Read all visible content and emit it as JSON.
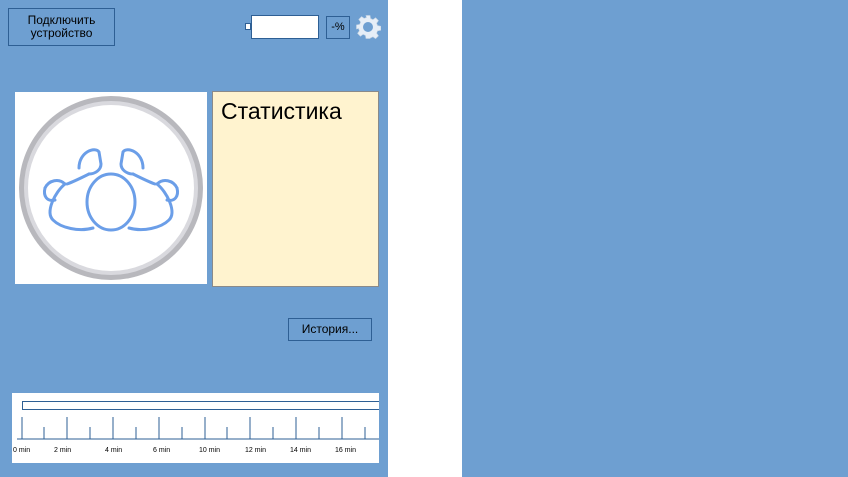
{
  "left_panel": {
    "connect_button": "Подключить устройство",
    "percent_button": "-%",
    "stats_title": "Статистика",
    "history_button": "История...",
    "timeline_labels": [
      "0 min",
      "2 min",
      "4 min",
      "6 min",
      "10 min",
      "12 min",
      "14 min",
      "16 min"
    ]
  },
  "colors": {
    "panel": "#6e9fd1",
    "stats_bg": "#fff3cf",
    "button_border": "#2e5f94",
    "icon_stroke": "#6b9ee8"
  },
  "icons": [
    "battery-icon",
    "gear-icon",
    "baby-icon"
  ]
}
